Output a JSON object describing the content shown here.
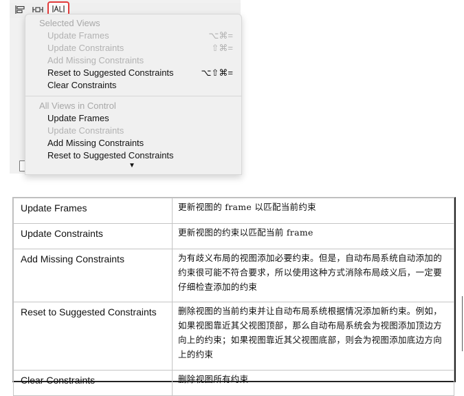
{
  "toolbar": {
    "align_icon": "align-icon",
    "pin_icon": "pin-icon",
    "resolve_icon": "resolve-auto-layout-icon",
    "highlight_color": "#e23a3a"
  },
  "menu": {
    "section1_header": "Selected Views",
    "section1_items": [
      {
        "label": "Update Frames",
        "shortcut": "⌥⌘=",
        "enabled": false
      },
      {
        "label": "Update Constraints",
        "shortcut": "⇧⌘=",
        "enabled": false
      },
      {
        "label": "Add Missing Constraints",
        "shortcut": "",
        "enabled": false
      },
      {
        "label": "Reset to Suggested Constraints",
        "shortcut": "⌥⇧⌘=",
        "enabled": true
      },
      {
        "label": "Clear Constraints",
        "shortcut": "",
        "enabled": true
      }
    ],
    "section2_header": "All Views in Control",
    "section2_items": [
      {
        "label": "Update Frames",
        "enabled": true
      },
      {
        "label": "Update Constraints",
        "enabled": false
      },
      {
        "label": "Add Missing Constraints",
        "enabled": true
      },
      {
        "label": "Reset to Suggested Constraints",
        "enabled": true
      }
    ],
    "more_arrow": "▼"
  },
  "table": {
    "rows": [
      {
        "term": "Update Frames",
        "desc": "更新视图的 frame 以匹配当前约束"
      },
      {
        "term": "Update Constraints",
        "desc": "更新视图的约束以匹配当前 frame"
      },
      {
        "term": "Add Missing Constraints",
        "desc": "为有歧义布局的视图添加必要约束。但是，自动布局系统自动添加的约束很可能不符合要求，所以使用这种方式消除布局歧义后，一定要仔细检查添加的约束"
      },
      {
        "term": "Reset to Suggested Constraints",
        "desc": "删除视图的当前约束并让自动布局系统根据情况添加新约束。例如，如果视图靠近其父视图顶部，那么自动布局系统会为视图添加顶边方向上的约束；如果视图靠近其父视图底部，则会为视图添加底边方向上的约束"
      },
      {
        "term": "Clear Constraints",
        "desc": "删除视图所有约束"
      }
    ]
  }
}
